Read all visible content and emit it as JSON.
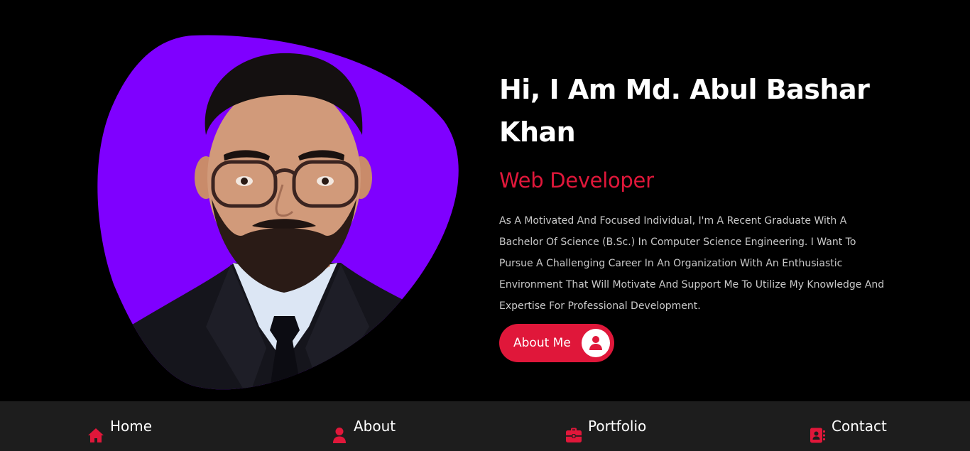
{
  "colors": {
    "accent": "#e0173a",
    "blob": "#7f00ff",
    "background": "#000000",
    "nav_background": "#1d1d1d",
    "body_text": "#c9c9c9"
  },
  "intro": {
    "title_line1": "Hi, I Am Md. Abul Bashar",
    "title_line2": "Khan",
    "role": "Web Developer",
    "description": "As A Motivated And Focused Individual, I'm A Recent Graduate With A Bachelor Of Science (B.Sc.) In Computer Science Engineering. I Want To Pursue A Challenging Career In An Organization With An Enthusiastic Environment That Will Motivate And Support Me To Utilize My Knowledge And Expertise For Professional Development."
  },
  "about_button": {
    "label": "About Me",
    "icon": "user-circle-icon"
  },
  "nav": {
    "items": [
      {
        "label": "Home",
        "icon": "home-icon"
      },
      {
        "label": "About",
        "icon": "user-icon"
      },
      {
        "label": "Portfolio",
        "icon": "briefcase-icon"
      },
      {
        "label": "Contact",
        "icon": "address-book-icon"
      }
    ]
  }
}
